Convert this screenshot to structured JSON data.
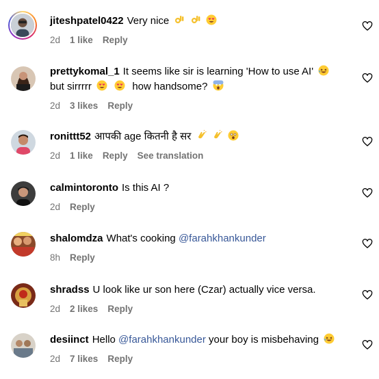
{
  "comments": [
    {
      "username": "jiteshpatel0422",
      "text": "Very nice",
      "emojis": [
        "ok-hand-emoji",
        "ok-hand-emoji",
        "heart-eyes-emoji"
      ],
      "time": "2d",
      "likes": "1 like",
      "reply": "Reply",
      "has_story_ring": true
    },
    {
      "username": "prettykomal_1",
      "text": "It seems like sir is learning 'How to use AI'",
      "text_line2": "but sirrrrr",
      "text_line2_end": "how handsome?",
      "emojis": [
        "laughing-emoji",
        "heart-eyes-emoji",
        "heart-eyes-emoji",
        "screaming-emoji"
      ],
      "time": "2d",
      "likes": "3 likes",
      "reply": "Reply"
    },
    {
      "username": "ronittt52",
      "text": "आपकी age कितनी है सर",
      "emojis": [
        "clapping-emoji",
        "clapping-emoji",
        "surprised-emoji"
      ],
      "time": "2d",
      "likes": "1 like",
      "reply": "Reply",
      "see_translation": "See translation"
    },
    {
      "username": "calmintoronto",
      "text": "Is this AI ?",
      "time": "2d",
      "reply": "Reply"
    },
    {
      "username": "shalomdza",
      "text": "What's cooking",
      "mention": "@farahkhankunder",
      "time": "8h",
      "reply": "Reply"
    },
    {
      "username": "shradss",
      "text": "U look like ur son here (Czar) actually vice versa.",
      "time": "2d",
      "likes": "2 likes",
      "reply": "Reply"
    },
    {
      "username": "desiinct",
      "text_before": "Hello",
      "mention": "@farahkhankunder",
      "text": "your boy is misbehaving",
      "emojis": [
        "laughing-emoji"
      ],
      "time": "2d",
      "likes": "7 likes",
      "reply": "Reply"
    }
  ],
  "colors": {
    "meta_text": "#737373",
    "mention": "#385898"
  }
}
